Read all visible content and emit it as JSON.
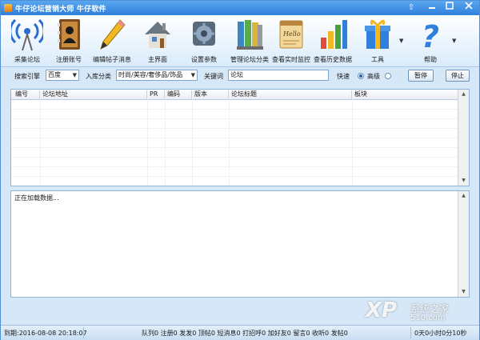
{
  "window": {
    "title": "牛仔论坛营销大师 牛仔软件"
  },
  "toolbar": {
    "items": [
      {
        "label": "采集论坛"
      },
      {
        "label": "注册账号"
      },
      {
        "label": "编辑帖子消息"
      },
      {
        "label": "主界面"
      },
      {
        "label": "设置参数"
      },
      {
        "label": "管理论坛分类"
      },
      {
        "label": "查看实时监控"
      },
      {
        "label": "查看历史数据"
      },
      {
        "label": "工具"
      },
      {
        "label": "帮助"
      }
    ]
  },
  "search": {
    "engine_label": "搜索引擎",
    "engine_value": "百度",
    "category_label": "入库分类",
    "category_value": "时尚/美容/奢侈品/饰品",
    "keyword_label": "关键词",
    "keyword_value": "论坛",
    "speed_fast": "快速",
    "speed_advanced": "高级",
    "pause_label": "暂停",
    "stop_label": "停止"
  },
  "table": {
    "columns": [
      "编号",
      "论坛地址",
      "PR",
      "编码",
      "版本",
      "论坛标题",
      "板块"
    ]
  },
  "log": {
    "text": "正在加载数据..."
  },
  "status": {
    "expiry": "到期:2016-08-08 20:18:07",
    "counts": "队列0 注册0 发发0 顶帖0 短消息0 打招呼0 加好友0 留言0 收听0 发帖0",
    "elapsed": "0天0小时0分10秒"
  },
  "watermark": {
    "logo": "XP",
    "line1": "系统之家",
    "line2": "510.com"
  },
  "colors": {
    "accent": "#2f7fdc",
    "window_bg": "#d6e7f7"
  }
}
